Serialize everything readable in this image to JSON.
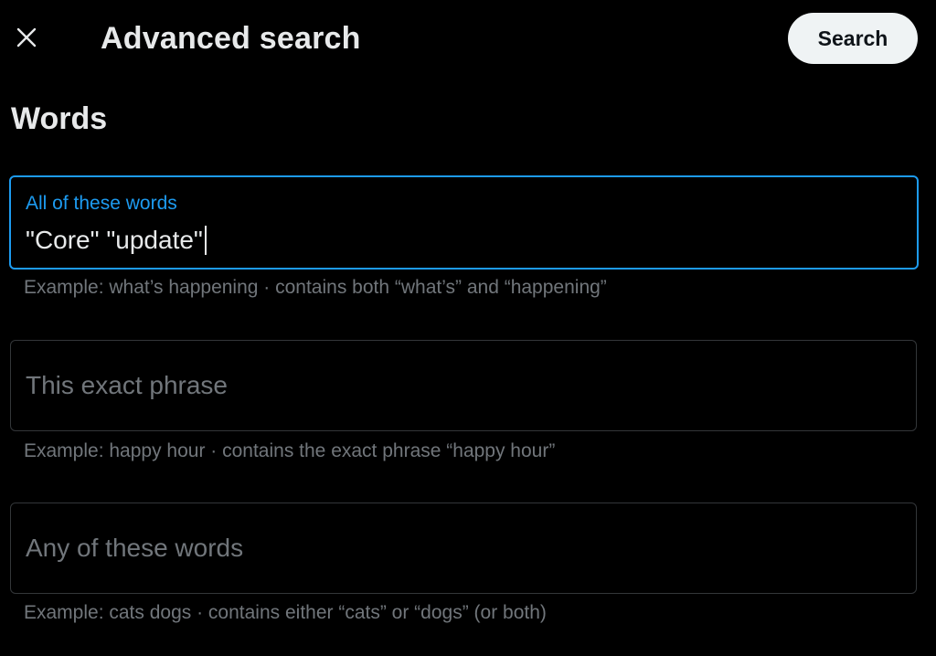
{
  "header": {
    "close_icon": "close-icon",
    "title": "Advanced search",
    "search_button_label": "Search"
  },
  "section": {
    "title": "Words"
  },
  "fields": {
    "all_words": {
      "label": "All of these words",
      "value": "\"Core\" \"update\"",
      "hint": "Example: what’s happening · contains both “what’s” and “happening”",
      "focused": true
    },
    "exact_phrase": {
      "placeholder": "This exact phrase",
      "value": "",
      "hint": "Example: happy hour · contains the exact phrase “happy hour”"
    },
    "any_words": {
      "placeholder": "Any of these words",
      "value": "",
      "hint": "Example: cats dogs · contains either “cats” or “dogs” (or both)"
    }
  },
  "colors": {
    "background": "#000000",
    "accent": "#1d9bf0",
    "text_primary": "#e7e9ea",
    "text_secondary": "#71767b",
    "border": "#333639",
    "button_bg": "#eff3f4"
  }
}
